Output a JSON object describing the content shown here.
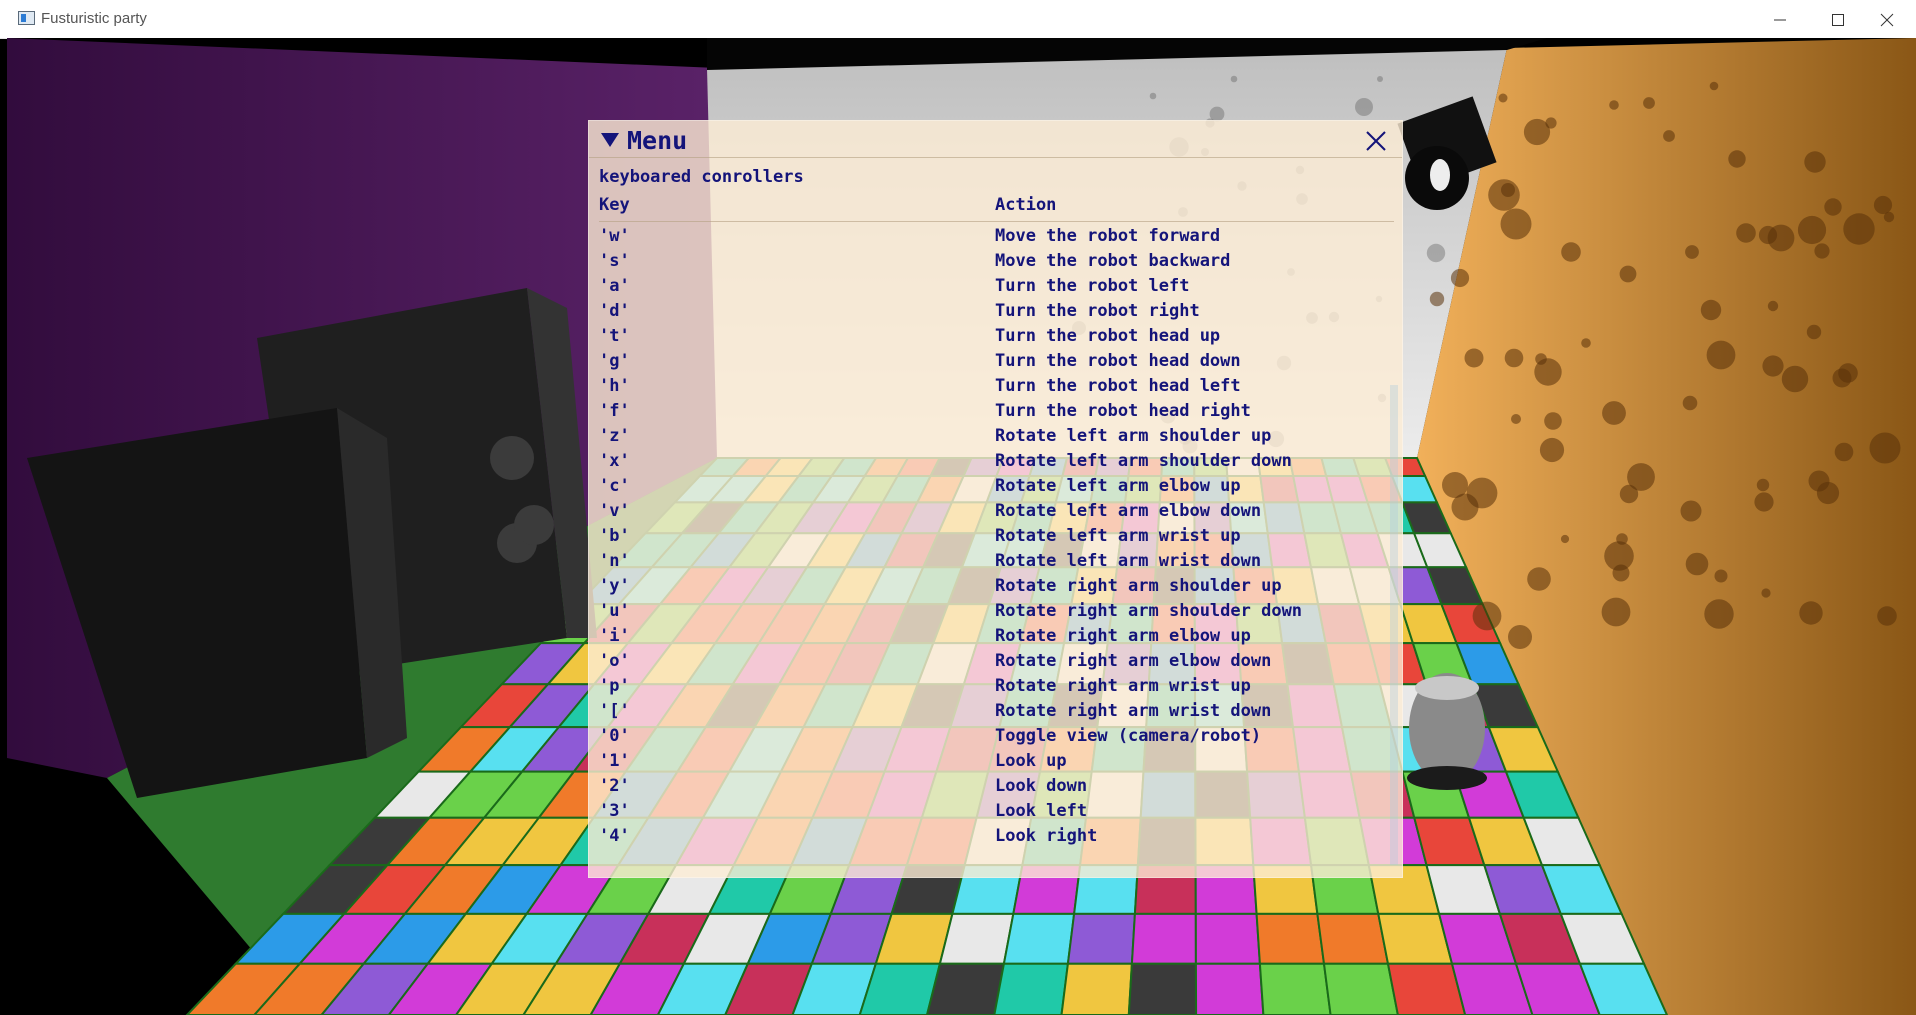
{
  "window": {
    "title": "Fusturistic party",
    "buttons": [
      "minimize-icon",
      "maximize-icon",
      "close-icon"
    ]
  },
  "menu": {
    "title": "Menu",
    "collapse_icon": "triangle-down-icon",
    "close_icon": "close-icon",
    "section_label": "keyboared conrollers",
    "columns": {
      "key": "Key",
      "action": "Action"
    },
    "rows": [
      {
        "key": "'w'",
        "action": "Move the robot forward"
      },
      {
        "key": "'s'",
        "action": "Move the robot backward"
      },
      {
        "key": "'a'",
        "action": "Turn the robot left"
      },
      {
        "key": "'d'",
        "action": "Turn the robot right"
      },
      {
        "key": "'t'",
        "action": "Turn the robot head up"
      },
      {
        "key": "'g'",
        "action": "Turn the robot head down"
      },
      {
        "key": "'h'",
        "action": "Turn the robot head left"
      },
      {
        "key": "'f'",
        "action": "Turn the robot head right"
      },
      {
        "key": "'z'",
        "action": "Rotate left arm shoulder up"
      },
      {
        "key": "'x'",
        "action": "Rotate left arm shoulder down"
      },
      {
        "key": "'c'",
        "action": "Rotate left arm elbow up"
      },
      {
        "key": "'v'",
        "action": "Rotate left arm elbow down"
      },
      {
        "key": "'b'",
        "action": "Rotate left arm wrist up"
      },
      {
        "key": "'n'",
        "action": "Rotate left arm wrist down"
      },
      {
        "key": "'y'",
        "action": "Rotate right arm shoulder up"
      },
      {
        "key": "'u'",
        "action": "Rotate right arm shoulder down"
      },
      {
        "key": "'i'",
        "action": "Rotate right arm elbow up"
      },
      {
        "key": "'o'",
        "action": "Rotate right arm elbow down"
      },
      {
        "key": "'p'",
        "action": "Rotate right arm wrist up"
      },
      {
        "key": "'['",
        "action": "Rotate right arm wrist down"
      },
      {
        "key": "'0'",
        "action": "Toggle view (camera/robot)"
      },
      {
        "key": "'1'",
        "action": "Look up"
      },
      {
        "key": "'2'",
        "action": "Look down"
      },
      {
        "key": "'3'",
        "action": "Look left"
      },
      {
        "key": "'4'",
        "action": "Look right"
      }
    ]
  },
  "colors": {
    "left_wall": "#3e0f4a",
    "right_wall": "#b6782a",
    "back_wall": "#d8d8d8",
    "menu_text": "#14147a",
    "menu_bg": "#fcecd4"
  }
}
